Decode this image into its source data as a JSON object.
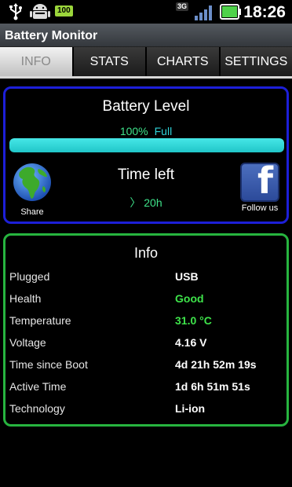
{
  "status_bar": {
    "battery_badge": "100",
    "network": "3G",
    "clock": "18:26",
    "icons": [
      "usb-icon",
      "android-debug-icon",
      "battery-badge",
      "3g-icon",
      "signal-icon",
      "battery-icon"
    ]
  },
  "app": {
    "title": "Battery Monitor"
  },
  "tabs": [
    {
      "label": "INFO",
      "active": true
    },
    {
      "label": "STATS",
      "active": false
    },
    {
      "label": "CHARTS",
      "active": false
    },
    {
      "label": "SETTINGS",
      "active": false
    }
  ],
  "battery_panel": {
    "title": "Battery Level",
    "percent": "100%",
    "status": "Full",
    "level_fraction": 1.0,
    "time_left_title": "Time left",
    "time_left_value": "〉 20h",
    "share_label": "Share",
    "follow_label": "Follow us",
    "fb_letter": "f"
  },
  "info_panel": {
    "title": "Info",
    "rows": [
      {
        "label": "Plugged",
        "value": "USB",
        "color": "white"
      },
      {
        "label": "Health",
        "value": "Good",
        "color": "green"
      },
      {
        "label": "Temperature",
        "value": "31.0 °C",
        "color": "green"
      },
      {
        "label": "Voltage",
        "value": "4.16 V",
        "color": "white"
      },
      {
        "label": "Time since Boot",
        "value": "4d 21h 52m 19s",
        "color": "white"
      },
      {
        "label": "Active Time",
        "value": "1d 6h 51m 51s",
        "color": "white"
      },
      {
        "label": "Technology",
        "value": "Li-ion",
        "color": "white"
      }
    ]
  },
  "colors": {
    "battery_border": "#1d1fd9",
    "info_border": "#27b43f",
    "level_fill": "#2fd2d7",
    "accent_green": "#3ee38a"
  }
}
